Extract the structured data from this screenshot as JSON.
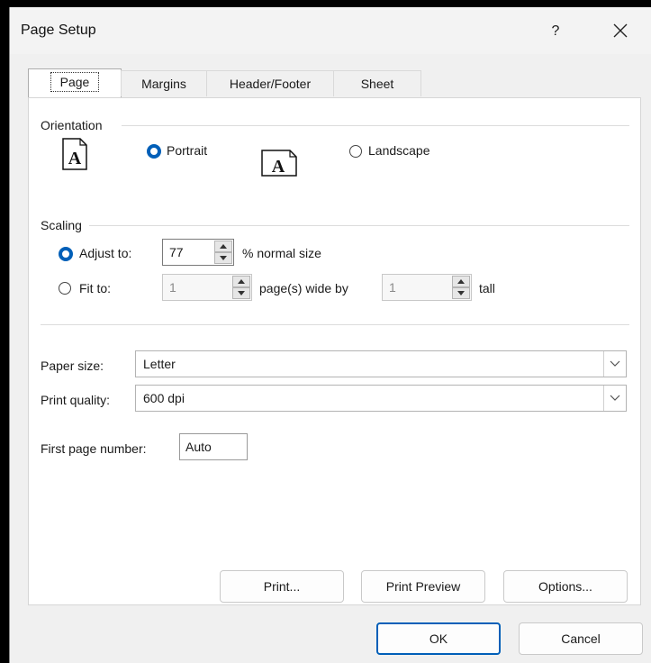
{
  "dialog": {
    "title": "Page Setup",
    "help_label": "?",
    "close_label": "✕"
  },
  "tabs": [
    {
      "label": "Page",
      "active": true
    },
    {
      "label": "Margins",
      "active": false
    },
    {
      "label": "Header/Footer",
      "active": false
    },
    {
      "label": "Sheet",
      "active": false
    }
  ],
  "orientation": {
    "group_label": "Orientation",
    "icon_letter": "A",
    "portrait_label": "Portrait",
    "landscape_label": "Landscape",
    "selected": "portrait"
  },
  "scaling": {
    "group_label": "Scaling",
    "adjust_to_label": "Adjust to:",
    "adjust_value": "77",
    "normal_size_label": "% normal size",
    "fit_to_label": "Fit to:",
    "fit_wide_value": "1",
    "pages_wide_label": "page(s) wide by",
    "fit_tall_value": "1",
    "tall_label": "tall",
    "selected": "adjust"
  },
  "paper_size": {
    "label": "Paper size:",
    "value": "Letter"
  },
  "print_quality": {
    "label": "Print quality:",
    "value": "600 dpi"
  },
  "first_page_number": {
    "label": "First page number:",
    "value": "Auto"
  },
  "buttons": {
    "print": "Print...",
    "print_preview": "Print Preview",
    "options": "Options...",
    "ok": "OK",
    "cancel": "Cancel"
  },
  "colors": {
    "accent": "#005fb8",
    "dialog_bg": "#f0f0f0",
    "panel_bg": "#ffffff"
  }
}
